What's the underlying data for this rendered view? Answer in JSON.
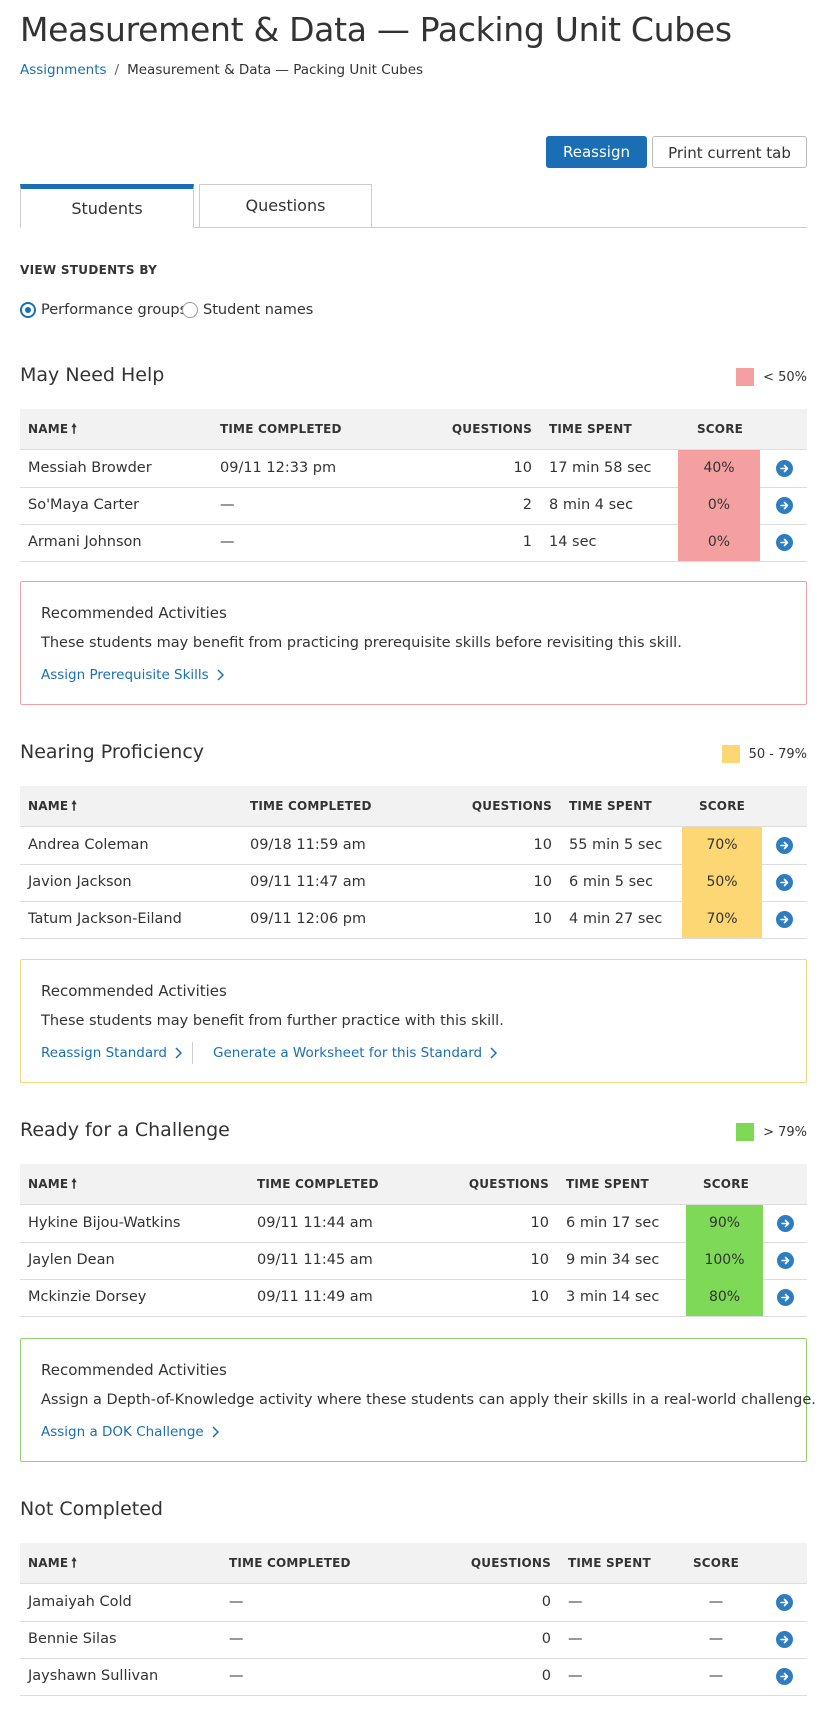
{
  "header": {
    "title": "Measurement & Data — Packing Unit Cubes",
    "breadcrumb": {
      "link": "Assignments",
      "separator": "/",
      "current": "Measurement & Data — Packing Unit Cubes"
    }
  },
  "toolbar": {
    "reassign_label": "Reassign",
    "print_label": "Print current tab"
  },
  "tabs": [
    {
      "label": "Students",
      "active": true
    },
    {
      "label": "Questions",
      "active": false
    }
  ],
  "view_by": {
    "label": "VIEW STUDENTS BY",
    "options": [
      {
        "label": "Performance groups",
        "selected": true
      },
      {
        "label": "Student names",
        "selected": false
      }
    ]
  },
  "columns": {
    "name": "NAME",
    "time_completed": "TIME COMPLETED",
    "questions": "QUESTIONS",
    "time_spent": "TIME SPENT",
    "score": "SCORE"
  },
  "colors": {
    "accent": "#1a6fb4",
    "needs_help": "#f5a0a0",
    "nearing": "#fdd773",
    "ready": "#7ed957"
  },
  "groups": {
    "help": {
      "title": "May Need Help",
      "legend": "< 50%",
      "rows": [
        {
          "name": "Messiah Browder",
          "time_completed": "09/11 12:33 pm",
          "questions": "10",
          "time_spent": "17 min 58 sec",
          "score": "40%"
        },
        {
          "name": "So'Maya Carter",
          "time_completed": "—",
          "questions": "2",
          "time_spent": "8 min 4 sec",
          "score": "0%"
        },
        {
          "name": "Armani Johnson",
          "time_completed": "—",
          "questions": "1",
          "time_spent": "14 sec",
          "score": "0%"
        }
      ],
      "rec": {
        "title": "Recommended Activities",
        "text": "These students may benefit from practicing prerequisite skills before revisiting this skill.",
        "links": [
          "Assign Prerequisite Skills"
        ]
      }
    },
    "nearing": {
      "title": "Nearing Proficiency",
      "legend": "50 - 79%",
      "rows": [
        {
          "name": "Andrea Coleman",
          "time_completed": "09/18 11:59 am",
          "questions": "10",
          "time_spent": "55 min 5 sec",
          "score": "70%"
        },
        {
          "name": "Javion Jackson",
          "time_completed": "09/11 11:47 am",
          "questions": "10",
          "time_spent": "6 min 5 sec",
          "score": "50%"
        },
        {
          "name": "Tatum Jackson-Eiland",
          "time_completed": "09/11 12:06 pm",
          "questions": "10",
          "time_spent": "4 min 27 sec",
          "score": "70%"
        }
      ],
      "rec": {
        "title": "Recommended Activities",
        "text": "These students may benefit from further practice with this skill.",
        "links": [
          "Reassign Standard",
          "Generate a Worksheet for this Standard"
        ]
      }
    },
    "ready": {
      "title": "Ready for a Challenge",
      "legend": "> 79%",
      "rows": [
        {
          "name": "Hykine Bijou-Watkins",
          "time_completed": "09/11 11:44 am",
          "questions": "10",
          "time_spent": "6 min 17 sec",
          "score": "90%"
        },
        {
          "name": "Jaylen Dean",
          "time_completed": "09/11 11:45 am",
          "questions": "10",
          "time_spent": "9 min 34 sec",
          "score": "100%"
        },
        {
          "name": "Mckinzie Dorsey",
          "time_completed": "09/11 11:49 am",
          "questions": "10",
          "time_spent": "3 min 14 sec",
          "score": "80%"
        }
      ],
      "rec": {
        "title": "Recommended Activities",
        "text": "Assign a Depth-of-Knowledge activity where these students can apply their skills in a real-world challenge.",
        "links": [
          "Assign a DOK Challenge"
        ]
      }
    },
    "notdone": {
      "title": "Not Completed",
      "rows": [
        {
          "name": "Jamaiyah Cold",
          "time_completed": "—",
          "questions": "0",
          "time_spent": "—",
          "score": "—"
        },
        {
          "name": "Bennie Silas",
          "time_completed": "—",
          "questions": "0",
          "time_spent": "—",
          "score": "—"
        },
        {
          "name": "Jayshawn Sullivan",
          "time_completed": "—",
          "questions": "0",
          "time_spent": "—",
          "score": "—"
        }
      ]
    }
  }
}
